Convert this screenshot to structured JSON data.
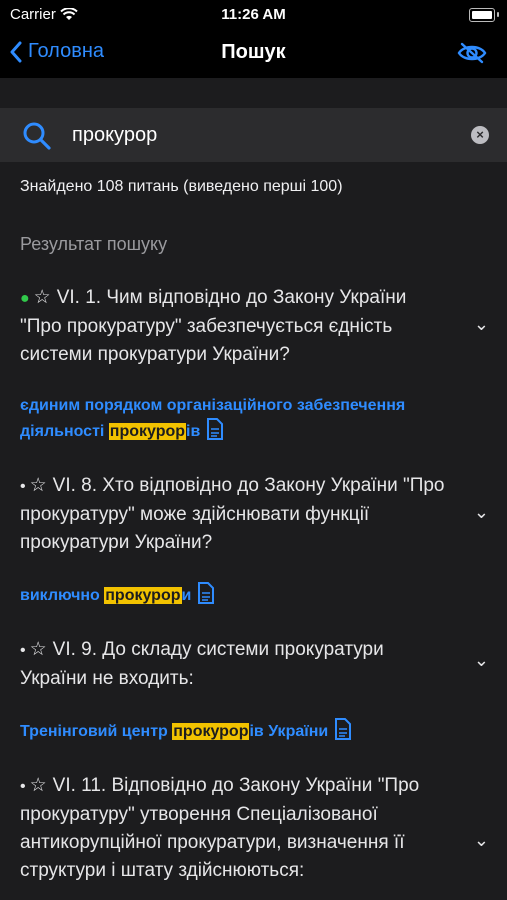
{
  "status": {
    "carrier": "Carrier",
    "time": "11:26 AM"
  },
  "nav": {
    "back_label": "Головна",
    "title": "Пошук",
    "eye_icon": "eye-slash-icon"
  },
  "search": {
    "value": "прокурор",
    "placeholder": ""
  },
  "found_text": "Знайдено 108 питань (виведено перші 100)",
  "section_title": "Результат пошуку",
  "accent_color": "#2f8cff",
  "highlight_color": "#f2c200",
  "items": [
    {
      "status_dot": "green",
      "question": "VI. 1. Чим відповідно до Закону України \"Про прокуратуру\" забезпечується єдність системи прокуратури України?",
      "answer_pre": "єдиним порядком організаційного забезпечення діяльності ",
      "answer_hl": "прокурор",
      "answer_post": "ів"
    },
    {
      "status_dot": "grey",
      "question": "VI. 8. Хто відповідно до Закону України \"Про прокуратуру\" може здійснювати функції прокуратури України?",
      "answer_pre": "виключно ",
      "answer_hl": "прокурор",
      "answer_post": "и"
    },
    {
      "status_dot": "grey",
      "question": "VI. 9. До складу системи прокуратури України не входить:",
      "answer_pre": "Тренінговий центр ",
      "answer_hl": "прокурор",
      "answer_post": "ів України"
    },
    {
      "status_dot": "grey",
      "question": "VI. 11. Відповідно до Закону України \"Про прокуратуру\" утворення Спеціалізованої антикорупційної прокуратури, визначення її структури і штату здійснюються:"
    }
  ]
}
